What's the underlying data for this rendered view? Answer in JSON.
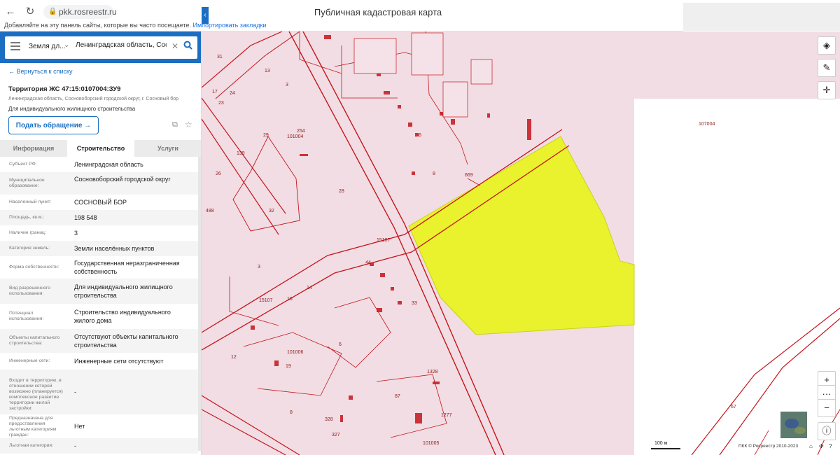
{
  "browser": {
    "url": "pkk.rosreestr.ru",
    "page_title": "Публичная кадастровая карта",
    "bookmarks_hint": "Добавляйте на эту панель сайты, которые вы часто посещаете.",
    "bookmarks_import": "Импортировать закладки"
  },
  "search": {
    "type_value": "Земля дл...",
    "query": "Ленинградская область, Сосн"
  },
  "panel": {
    "back_link": "← Вернуться к списку",
    "title": "Территория ЖС 47:15:0107004:ЗУ9",
    "address": "Ленинградская область, Сосновоборский городской округ, г. Сосновый бор",
    "use": "Для индивидуального жилищного строительства",
    "appeal_button": "Подать обращение →",
    "tabs": [
      "Информация",
      "Строительство",
      "Услуги"
    ],
    "active_tab": "Строительство",
    "rows": [
      {
        "key": "Субъект РФ:",
        "value": "Ленинградская область"
      },
      {
        "key": "Муниципальное образование:",
        "value": "Сосновоборский городской округ"
      },
      {
        "key": "Населенный пункт:",
        "value": "СОСНОВЫЙ БОР"
      },
      {
        "key": "Площадь, кв.м.:",
        "value": "198 548"
      },
      {
        "key": "Наличие границ:",
        "value": "3"
      },
      {
        "key": "Категория земель:",
        "value": "Земли населённых пунктов"
      },
      {
        "key": "Форма собственности:",
        "value": "Государственная неразграниченная собственность"
      },
      {
        "key": "Вид разрешенного использования:",
        "value": "Для индивидуального жилищного строительства"
      },
      {
        "key": "Потенциал использования:",
        "value": "Строительство индивидуального жилого дома"
      },
      {
        "key": "Объекты капитального строительства:",
        "value": "Отсутствуют объекты капитального строительства"
      },
      {
        "key": "Инженерные сети:",
        "value": "Инженерные сети отсутствуют"
      },
      {
        "key": "Входит в территорию, в отношении которой возможно (планируется) комплексное развитие территории жилой застройки:",
        "value": "-"
      },
      {
        "key": "Предназначена для предоставления льготным категориям граждан:",
        "value": "Нет"
      },
      {
        "key": "Льготная категория:",
        "value": "-"
      }
    ]
  },
  "map": {
    "scale": "100 м",
    "copyright": "ПКК © Росреестр 2010-2023",
    "labels": [
      {
        "t": "31"
      },
      {
        "t": "13"
      },
      {
        "t": "3"
      },
      {
        "t": "17"
      },
      {
        "t": "24"
      },
      {
        "t": "23"
      },
      {
        "t": "254"
      },
      {
        "t": "101004"
      },
      {
        "t": "29"
      },
      {
        "t": "139"
      },
      {
        "t": "26"
      },
      {
        "t": "28"
      },
      {
        "t": "32"
      },
      {
        "t": "488"
      },
      {
        "t": "3"
      },
      {
        "t": "44"
      },
      {
        "t": "16"
      },
      {
        "t": "14"
      },
      {
        "t": "15107"
      },
      {
        "t": "15107"
      },
      {
        "t": "101006"
      },
      {
        "t": "12"
      },
      {
        "t": "19"
      },
      {
        "t": "6"
      },
      {
        "t": "1328"
      },
      {
        "t": "87"
      },
      {
        "t": "1277"
      },
      {
        "t": "328"
      },
      {
        "t": "327"
      },
      {
        "t": "101005"
      },
      {
        "t": "8"
      },
      {
        "t": "669"
      },
      {
        "t": "8"
      },
      {
        "t": "6"
      },
      {
        "t": "107004"
      },
      {
        "t": "67"
      },
      {
        "t": "33"
      }
    ]
  },
  "colors": {
    "brand_blue": "#1b6ec2",
    "parcel_pink": "#f2dde4",
    "selected_yellow": "#e9f22c",
    "boundary_red": "#c4161c"
  },
  "icons": {
    "back": "arrow-left-icon",
    "refresh": "refresh-icon",
    "lock": "lock-icon",
    "menu": "hamburger-icon",
    "chevron": "chevron-down-icon",
    "clear": "close-icon",
    "search": "search-icon",
    "collapse": "chevron-left-icon",
    "copy": "copy-icon",
    "favorite": "star-icon",
    "layers": "layers-icon",
    "ruler": "ruler-icon",
    "locate": "crosshair-icon",
    "zoom_in": "plus-icon",
    "more": "more-icon",
    "zoom_out": "minus-icon",
    "info": "info-icon"
  }
}
